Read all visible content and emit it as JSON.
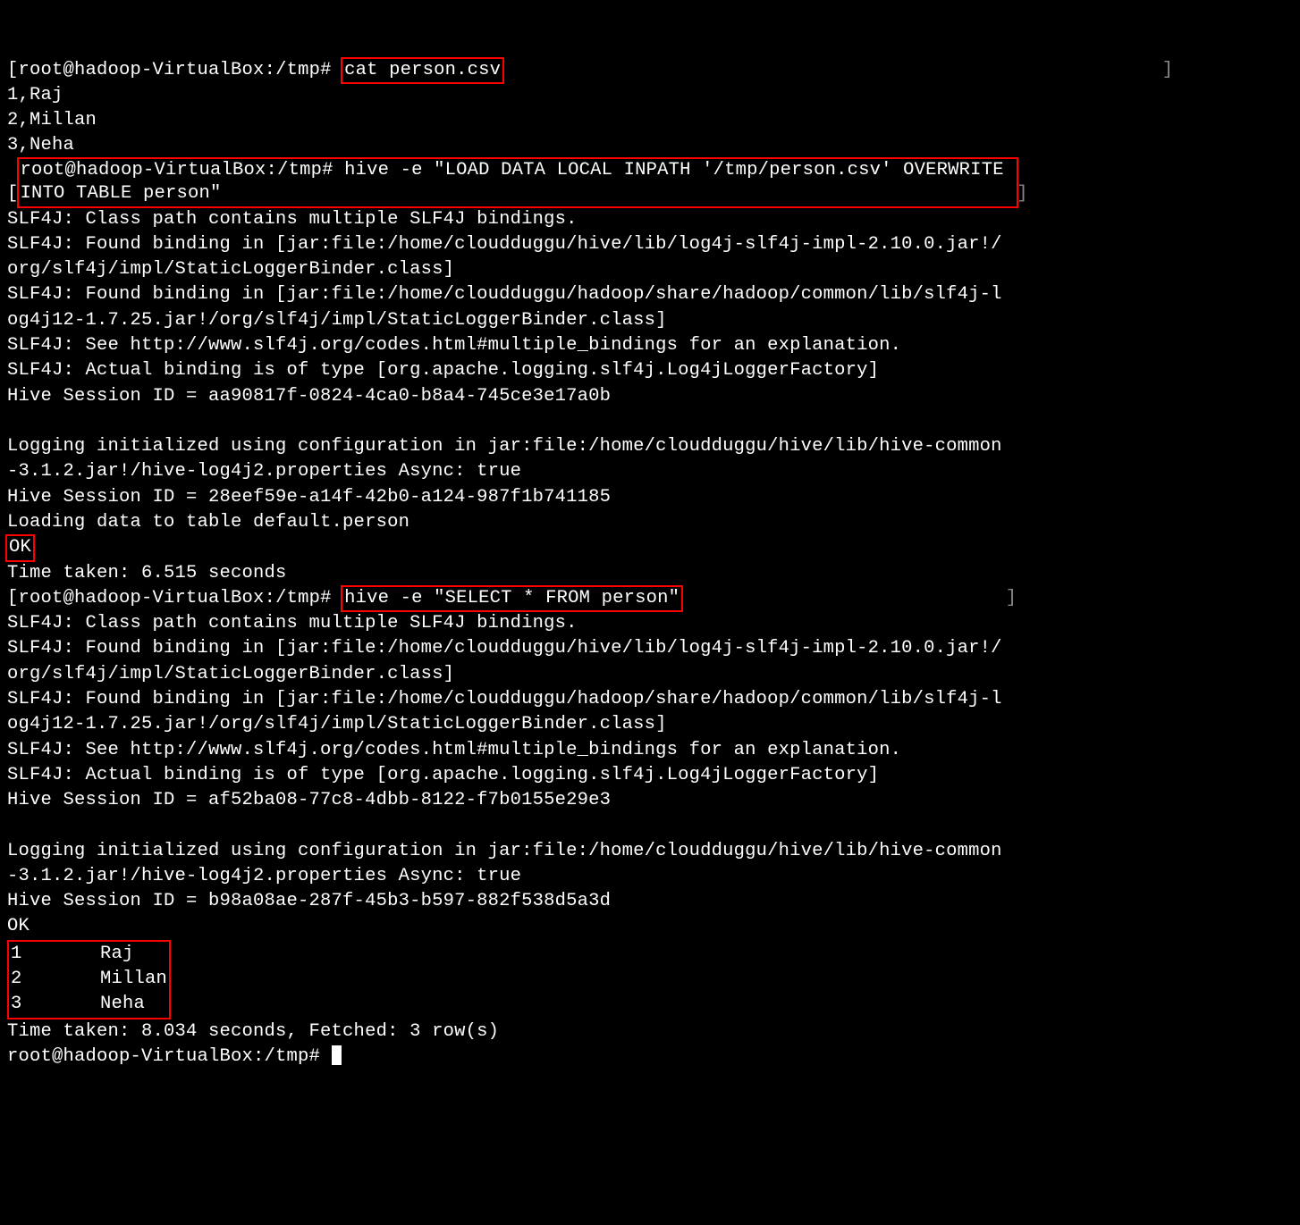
{
  "prompt1_open": "[",
  "prompt1_user": "root@hadoop-VirtualBox",
  "prompt1_path": ":/tmp# ",
  "cmd1": "cat person.csv",
  "prompt1_close": "]",
  "csv_line1": "1,Raj",
  "csv_line2": "2,Millan",
  "csv_line3": "3,Neha",
  "cmd2_full": "root@hadoop-VirtualBox:/tmp# hive -e \"LOAD DATA LOCAL INPATH '/tmp/person.csv' OVERWRITE \nINTO TABLE person\"",
  "cmd2_open": "[",
  "cmd2_close": "]",
  "slf4j_block1_l1": "SLF4J: Class path contains multiple SLF4J bindings.",
  "slf4j_block1_l2": "SLF4J: Found binding in [jar:file:/home/cloudduggu/hive/lib/log4j-slf4j-impl-2.10.0.jar!/",
  "slf4j_block1_l3": "org/slf4j/impl/StaticLoggerBinder.class]",
  "slf4j_block1_l4": "SLF4J: Found binding in [jar:file:/home/cloudduggu/hadoop/share/hadoop/common/lib/slf4j-l",
  "slf4j_block1_l5": "og4j12-1.7.25.jar!/org/slf4j/impl/StaticLoggerBinder.class]",
  "slf4j_block1_l6": "SLF4J: See http://www.slf4j.org/codes.html#multiple_bindings for an explanation.",
  "slf4j_block1_l7": "SLF4J: Actual binding is of type [org.apache.logging.slf4j.Log4jLoggerFactory]",
  "session1": "Hive Session ID = aa90817f-0824-4ca0-b8a4-745ce3e17a0b",
  "blank": "",
  "logging1_l1": "Logging initialized using configuration in jar:file:/home/cloudduggu/hive/lib/hive-common",
  "logging1_l2": "-3.1.2.jar!/hive-log4j2.properties Async: true",
  "session2": "Hive Session ID = 28eef59e-a14f-42b0-a124-987f1b741185",
  "loading": "Loading data to table default.person",
  "ok1": "OK",
  "time1": "Time taken: 6.515 seconds",
  "prompt3_open": "[",
  "prompt3_user": "root@hadoop-VirtualBox",
  "prompt3_path": ":/tmp# ",
  "cmd3": "hive -e \"SELECT * FROM person\"",
  "prompt3_close": "]",
  "slf4j_block2_l1": "SLF4J: Class path contains multiple SLF4J bindings.",
  "slf4j_block2_l2": "SLF4J: Found binding in [jar:file:/home/cloudduggu/hive/lib/log4j-slf4j-impl-2.10.0.jar!/",
  "slf4j_block2_l3": "org/slf4j/impl/StaticLoggerBinder.class]",
  "slf4j_block2_l4": "SLF4J: Found binding in [jar:file:/home/cloudduggu/hadoop/share/hadoop/common/lib/slf4j-l",
  "slf4j_block2_l5": "og4j12-1.7.25.jar!/org/slf4j/impl/StaticLoggerBinder.class]",
  "slf4j_block2_l6": "SLF4J: See http://www.slf4j.org/codes.html#multiple_bindings for an explanation.",
  "slf4j_block2_l7": "SLF4J: Actual binding is of type [org.apache.logging.slf4j.Log4jLoggerFactory]",
  "session3": "Hive Session ID = af52ba08-77c8-4dbb-8122-f7b0155e29e3",
  "logging2_l1": "Logging initialized using configuration in jar:file:/home/cloudduggu/hive/lib/hive-common",
  "logging2_l2": "-3.1.2.jar!/hive-log4j2.properties Async: true",
  "session4": "Hive Session ID = b98a08ae-287f-45b3-b597-882f538d5a3d",
  "ok2": "OK",
  "result_row1": "1       Raj   ",
  "result_row2": "2       Millan",
  "result_row3": "3       Neha  ",
  "time2": "Time taken: 8.034 seconds, Fetched: 3 row(s)",
  "prompt4": "root@hadoop-VirtualBox:/tmp# "
}
